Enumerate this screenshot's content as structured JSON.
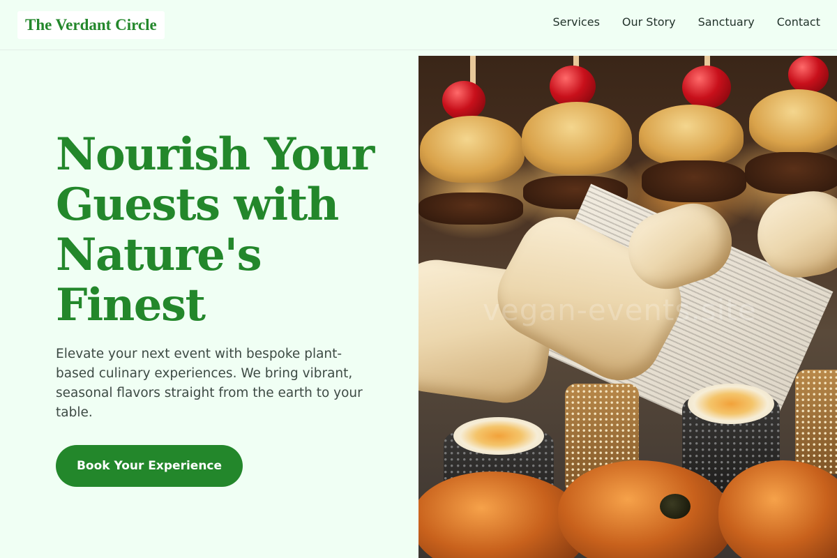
{
  "header": {
    "logo": "The Verdant Circle",
    "nav": [
      "Services",
      "Our Story",
      "Sanctuary",
      "Contact"
    ]
  },
  "hero": {
    "title": "Nourish Your Guests with Nature's Finest",
    "text": "Elevate your next event with bespoke plant-based culinary experiences. We bring vibrant, seasonal flavors straight from the earth to your table.",
    "cta": "Book Your Experience",
    "image_alt": "Assorted plant-based appetizers: sliders, wraps in newspaper, sushi rolls and pastries",
    "watermark": "vegan-events.site"
  },
  "colors": {
    "background": "#f0fff4",
    "brand_green": "#23872b",
    "text": "#3d4a44",
    "nav_text": "#22332b"
  }
}
